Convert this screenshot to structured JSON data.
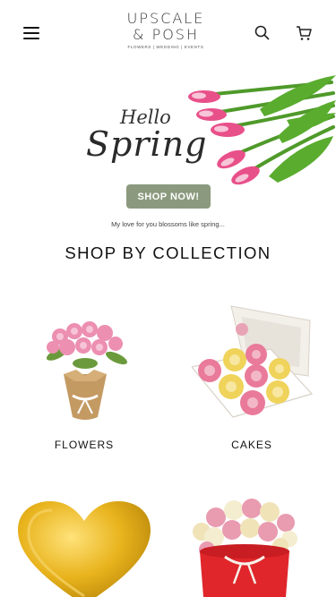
{
  "header": {
    "logo_line1": "UPSCALE",
    "logo_line2": "& POSH",
    "logo_tagline": "FLOWERS | WEDDING | EVENTS",
    "icons": [
      "hamburger-menu-icon",
      "search-icon",
      "cart-icon"
    ]
  },
  "hero": {
    "hello": "Hello",
    "spring": "Spring",
    "button_label": "SHOP NOW!",
    "tagline": "My love for you blossoms like spring...",
    "colors": {
      "button": "#8b9a7e"
    }
  },
  "collection": {
    "title": "SHOP BY COLLECTION",
    "items": [
      {
        "label": "FLOWERS"
      },
      {
        "label": "CAKES"
      },
      {
        "label": ""
      },
      {
        "label": ""
      }
    ]
  }
}
